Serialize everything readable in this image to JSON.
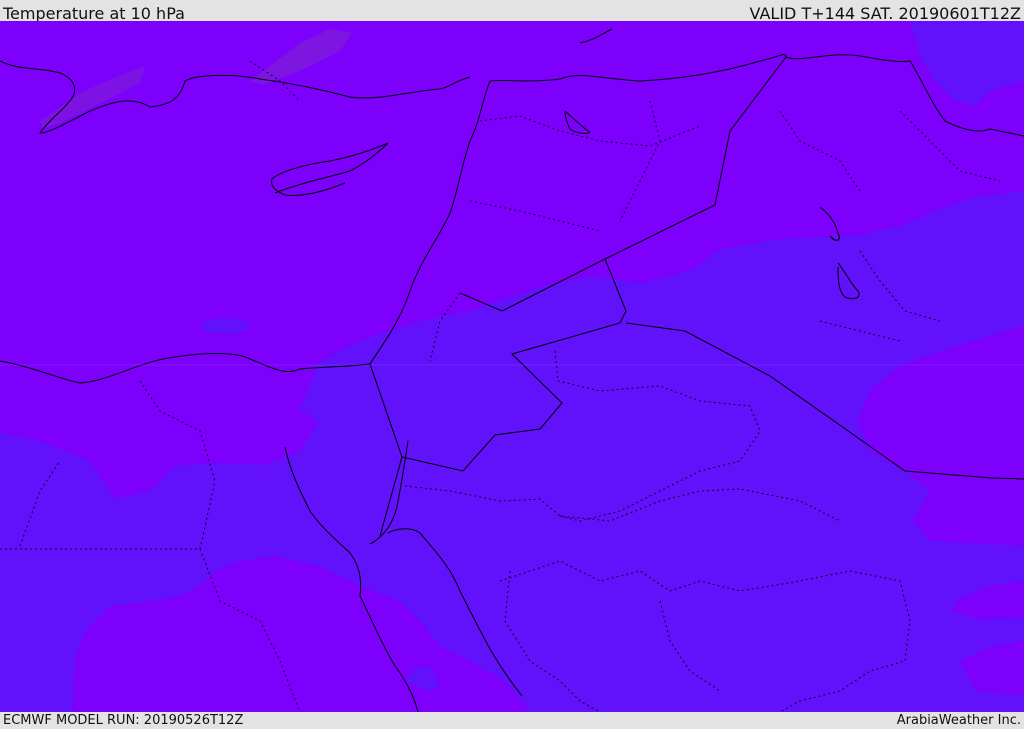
{
  "header": {
    "title": "Temperature at 10 hPa",
    "valid": "VALID T+144 SAT. 20190601T12Z"
  },
  "footer": {
    "model_run": "ECMWF MODEL RUN: 20190526T12Z",
    "credit": "ArabiaWeather Inc."
  },
  "map": {
    "colors": {
      "warm_field": "#7c00fb",
      "cool_field": "#6112fb",
      "warmest_streak": "#7d1fd6",
      "coastline": "#000000"
    }
  }
}
